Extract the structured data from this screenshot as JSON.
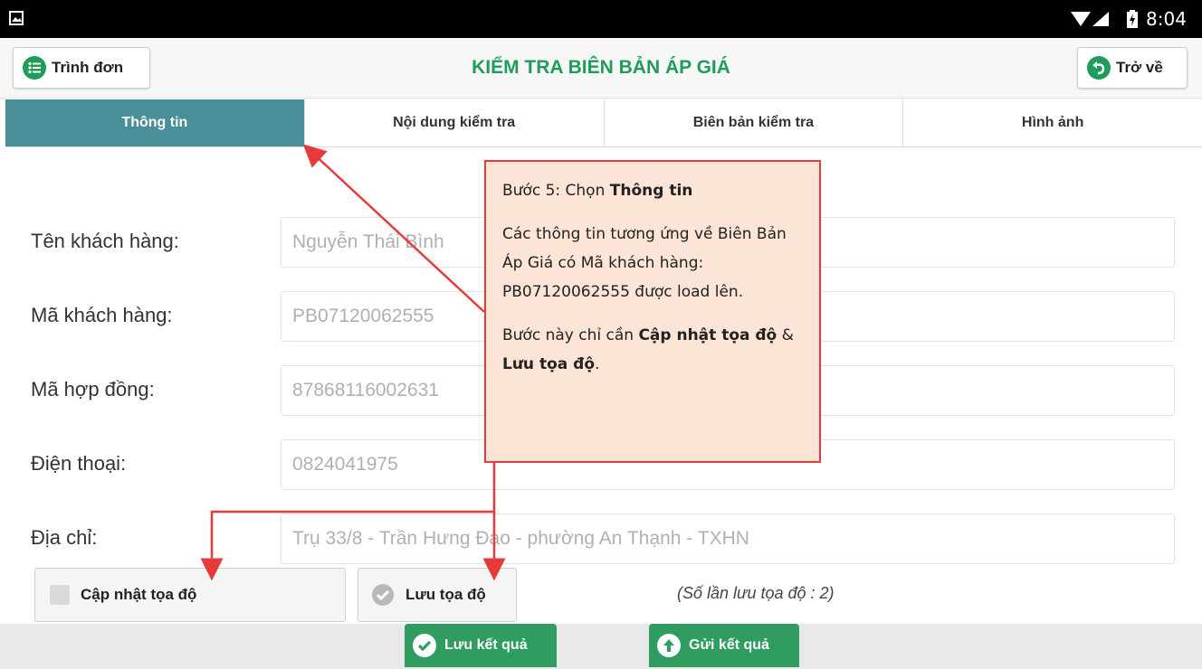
{
  "status": {
    "time": "8:04"
  },
  "header": {
    "menu_label": "Trình đơn",
    "title": "KIỂM TRA BIÊN BẢN ÁP GIÁ",
    "back_label": "Trở về"
  },
  "tabs": [
    {
      "label": "Thông tin",
      "active": true
    },
    {
      "label": "Nội dung kiểm tra",
      "active": false
    },
    {
      "label": "Biên bản kiểm tra",
      "active": false
    },
    {
      "label": "Hình ảnh",
      "active": false
    }
  ],
  "form": [
    {
      "label": "Tên khách hàng:",
      "value": "Nguyễn Thái Bình"
    },
    {
      "label": "Mã khách hàng:",
      "value": "PB07120062555"
    },
    {
      "label": "Mã hợp đồng:",
      "value": "87868116002631"
    },
    {
      "label": "Điện thoại:",
      "value": "0824041975"
    },
    {
      "label": "Địa chỉ:",
      "value": "Trụ 33/8 - Trần Hưng Đạo - phường An Thạnh - TXHN"
    }
  ],
  "actions": {
    "update_coords": "Cập nhật tọa độ",
    "save_coords": "Lưu tọa độ",
    "save_count": "(Số lần lưu tọa độ : 2)"
  },
  "bottom": {
    "save_result": "Lưu kết quả",
    "send_result": "Gửi kết quả"
  },
  "callout": {
    "step_prefix": "Bước 5: Chọn ",
    "step_bold": "Thông tin",
    "desc": "Các thông tin tương ứng về Biên Bản Áp Giá có Mã khách hàng: PB07120062555 được load lên.",
    "note_prefix": "Bước này chỉ cần ",
    "note_bold1": "Cập nhật tọa độ",
    "note_mid": " & ",
    "note_bold2": "Lưu tọa độ",
    "note_suffix": "."
  },
  "colors": {
    "accent_green": "#1f9c5a",
    "tab_active": "#4a8f98",
    "button_green": "#2e9d5f",
    "annotation_red": "#e83a3a",
    "callout_bg": "#fce4d6"
  }
}
